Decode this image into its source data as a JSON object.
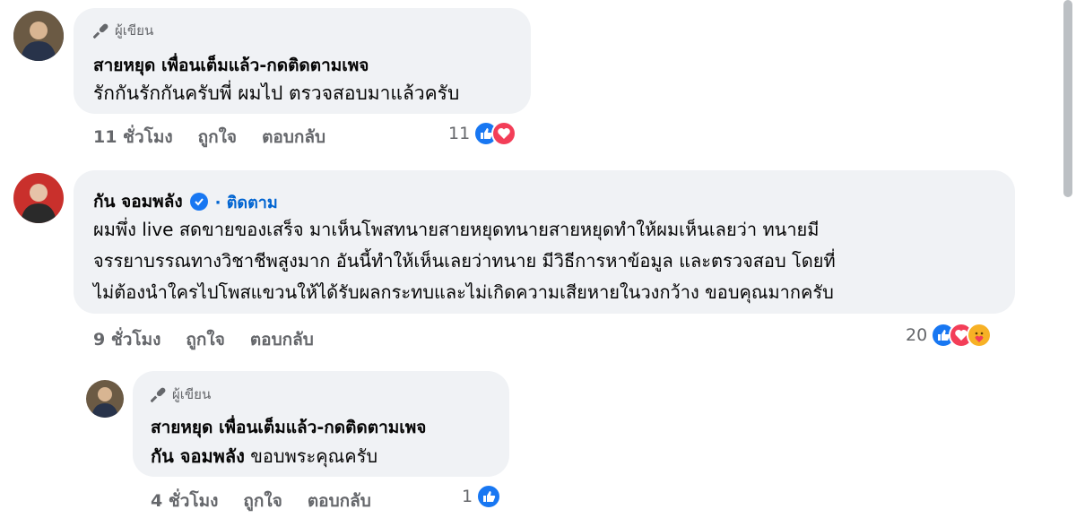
{
  "comments": [
    {
      "badge": "ผู้เขียน",
      "author": "สายหยุด เพื่อนเต็มแล้ว-กดติดตามเพจ",
      "text": [
        "รักกันรักกันครับพี่ ผมไป ตรวจสอบมาแล้วครับ"
      ],
      "time": "11 ชั่วโมง",
      "like_label": "ถูกใจ",
      "reply_label": "ตอบกลับ",
      "reaction_count": "11"
    },
    {
      "author": "กัน จอมพลัง",
      "follow_label": "· ติดตาม",
      "text": [
        "ผมพึ่ง live สดขายของเสร็จ มาเห็นโพสทนายสายหยุดทนายสายหยุดทำให้ผมเห็นเลยว่า ทนายมี",
        "จรรยาบรรณทางวิชาชีพสูงมาก อันนี้ทำให้เห็นเลยว่าทนาย มีวิธีการหาข้อมูล และตรวจสอบ โดยที่",
        "ไม่ต้องนำใครไปโพสแขวนให้ได้รับผลกระทบและไม่เกิดความเสียหายในวงกว้าง ขอบคุณมากครับ"
      ],
      "time": "9 ชั่วโมง",
      "like_label": "ถูกใจ",
      "reply_label": "ตอบกลับ",
      "reaction_count": "20"
    },
    {
      "badge": "ผู้เขียน",
      "author": "สายหยุด เพื่อนเต็มแล้ว-กดติดตามเพจ",
      "mention": "กัน จอมพลัง",
      "text": [
        "ขอบพระคุณครับ"
      ],
      "time": "4 ชั่วโมง",
      "like_label": "ถูกใจ",
      "reply_label": "ตอบกลับ",
      "reaction_count": "1"
    }
  ],
  "icons": {
    "author_badge": "microphone-icon",
    "verified": "verified-check-icon",
    "like": "thumbs-up-icon",
    "love": "heart-icon",
    "care": "care-emoji-icon"
  },
  "colors": {
    "like": "#1877f2",
    "love": "#f33e58",
    "care": "#f7b125",
    "follow": "#0064d1",
    "bubble": "#f0f2f5"
  }
}
